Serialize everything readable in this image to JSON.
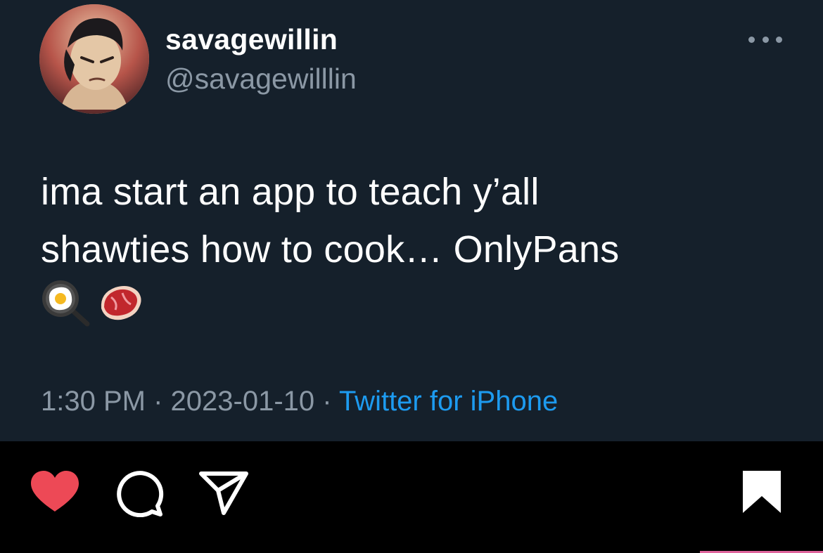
{
  "tweet": {
    "display_name": "savagewillin",
    "handle": "@savagewilllin",
    "text_line1": "ima start an app to teach y’all",
    "text_line2": "shawties how to cook… OnlyPans",
    "emojis": [
      "frying-pan-with-egg",
      "cut-of-meat"
    ],
    "time": "1:30 PM",
    "separator": " · ",
    "date": "2023-01-10",
    "source": "Twitter for iPhone"
  },
  "post_actions": {
    "icons": [
      "heart-icon-filled",
      "comment-icon",
      "share-icon",
      "bookmark-icon"
    ],
    "liked": true,
    "colors": {
      "heart": "#ed4956",
      "icon": "#ffffff"
    }
  },
  "colors": {
    "tweet_background": "#15202b",
    "secondary_text": "#8b98a5",
    "link": "#1d9bf0",
    "instagram_background": "#000000"
  }
}
